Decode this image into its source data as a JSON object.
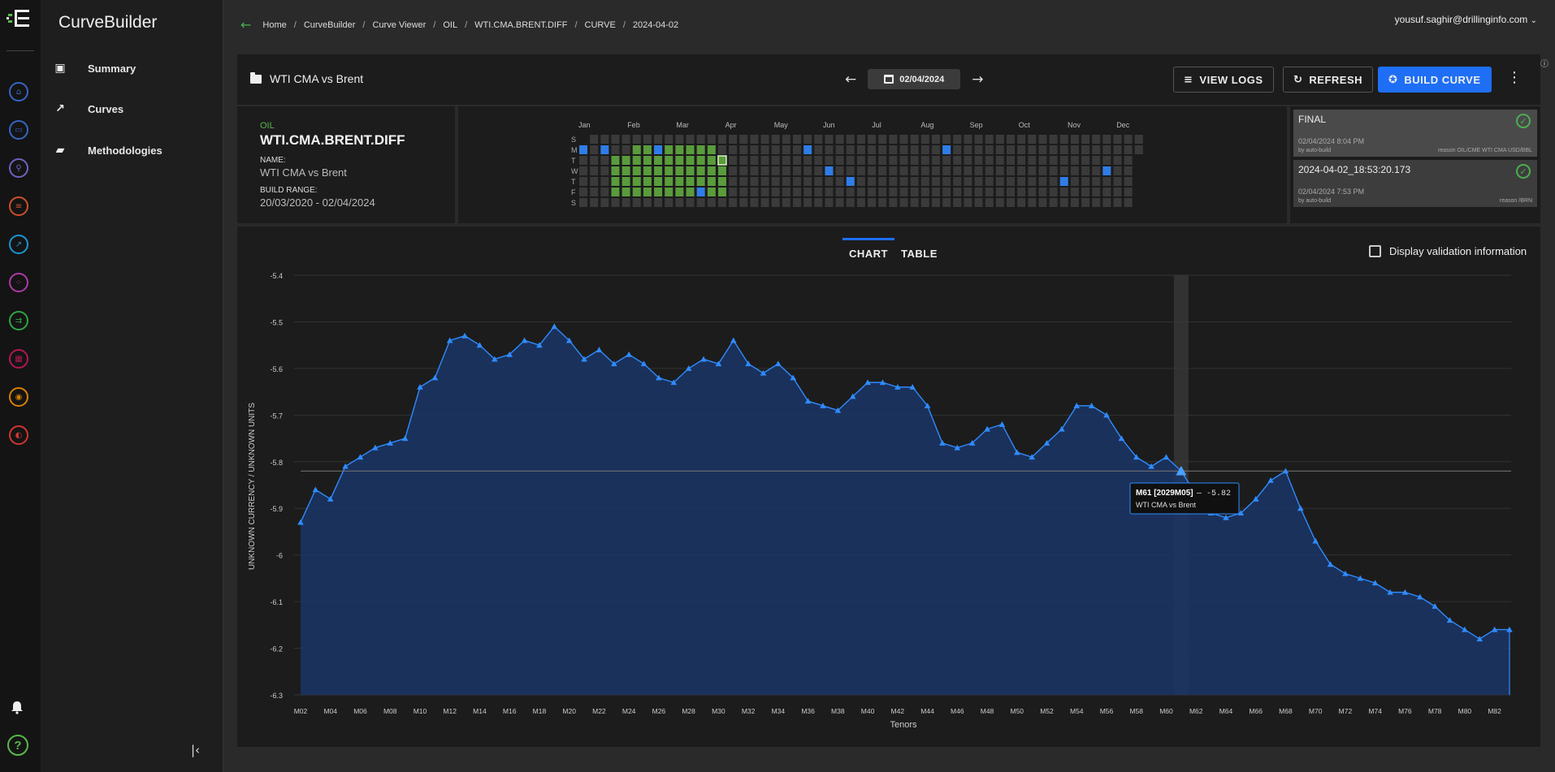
{
  "app": {
    "name": "CurveBuilder",
    "user": "yousuf.saghir@drillinginfo.com"
  },
  "nav": [
    {
      "label": "Summary",
      "icon": "id-card-icon"
    },
    {
      "label": "Curves",
      "icon": "trending-up-icon"
    },
    {
      "label": "Methodologies",
      "icon": "folder-chart-icon"
    }
  ],
  "rail_icons": [
    {
      "name": "bank-icon",
      "color": "#3a6ed8"
    },
    {
      "name": "folder-icon",
      "color": "#3a6ed8"
    },
    {
      "name": "database-search-icon",
      "color": "#7b6bd8"
    },
    {
      "name": "list-icon",
      "color": "#e4572e"
    },
    {
      "name": "trend-icon",
      "color": "#1aa3e8"
    },
    {
      "name": "scatter-icon",
      "color": "#c03fb8"
    },
    {
      "name": "flow-icon",
      "color": "#33b54a"
    },
    {
      "name": "calendar-icon",
      "color": "#c2185b"
    },
    {
      "name": "user-icon",
      "color": "#f08c00"
    },
    {
      "name": "gauge-icon",
      "color": "#e53935"
    }
  ],
  "breadcrumb": [
    "Home",
    "CurveBuilder",
    "Curve Viewer",
    "OIL",
    "WTI.CMA.BRENT.DIFF",
    "CURVE",
    "2024-04-02"
  ],
  "header": {
    "title": "WTI CMA vs Brent",
    "date": "02/04/2024",
    "view_logs": "VIEW LOGS",
    "refresh": "REFRESH",
    "build_curve": "BUILD CURVE"
  },
  "curve": {
    "commodity": "OIL",
    "code": "WTI.CMA.BRENT.DIFF",
    "name_label": "NAME:",
    "name": "WTI CMA vs Brent",
    "range_label": "BUILD RANGE:",
    "range": "20/03/2020 - 02/04/2024"
  },
  "calendar": {
    "months": [
      "Jan",
      "Feb",
      "Mar",
      "Apr",
      "May",
      "Jun",
      "Jul",
      "Aug",
      "Sep",
      "Oct",
      "Nov",
      "Dec"
    ],
    "days": [
      "S",
      "M",
      "T",
      "W",
      "T",
      "F",
      "S"
    ],
    "colors": {
      "empty": "#3a3a3a",
      "built": "#5a9b3c",
      "flagged": "#2f7de8",
      "selected": "#5a9b3c"
    }
  },
  "builds": [
    {
      "name": "FINAL",
      "date": "02/04/2024 8:04 PM",
      "by": "by auto-build",
      "reason": "reason OIL/CME WTI CMA USD/BBL",
      "status": "success"
    },
    {
      "name": "2024-04-02_18:53:20.173",
      "date": "02/04/2024 7:53 PM",
      "by": "by auto-build",
      "reason": "reason /BRN",
      "status": "success"
    }
  ],
  "tabs": {
    "chart": "CHART",
    "table": "TABLE"
  },
  "validation_label": "Display validation information",
  "tooltip": {
    "tenor": "M61 [2029M05]",
    "dash": "—",
    "value": "-5.82",
    "series": "WTI CMA vs Brent"
  },
  "colors": {
    "accent": "#1e6ff5",
    "line": "#2f8bff",
    "fill": "#1a3566",
    "green": "#4caf50"
  },
  "chart_data": {
    "type": "area",
    "xlabel": "Tenors",
    "ylabel": "UNKNOWN CURRENCY / UNKNOWN UNITS",
    "ylim": [
      -6.3,
      -5.4
    ],
    "yticks": [
      -5.4,
      -5.5,
      -5.6,
      -5.7,
      -5.8,
      -5.9,
      -6,
      -6.1,
      -6.2,
      -6.3
    ],
    "xticks": [
      "M02",
      "M04",
      "M06",
      "M08",
      "M10",
      "M12",
      "M14",
      "M16",
      "M18",
      "M20",
      "M22",
      "M24",
      "M26",
      "M28",
      "M30",
      "M32",
      "M34",
      "M36",
      "M38",
      "M40",
      "M42",
      "M44",
      "M46",
      "M48",
      "M50",
      "M52",
      "M54",
      "M56",
      "M58",
      "M60",
      "M62",
      "M64",
      "M66",
      "M68",
      "M70",
      "M72",
      "M74",
      "M76",
      "M78",
      "M80",
      "M82"
    ],
    "series": [
      {
        "name": "WTI CMA vs Brent",
        "x_start": "M02",
        "values": [
          -5.93,
          -5.86,
          -5.88,
          -5.81,
          -5.79,
          -5.77,
          -5.76,
          -5.75,
          -5.64,
          -5.62,
          -5.54,
          -5.53,
          -5.55,
          -5.58,
          -5.57,
          -5.54,
          -5.55,
          -5.51,
          -5.54,
          -5.58,
          -5.56,
          -5.59,
          -5.57,
          -5.59,
          -5.62,
          -5.63,
          -5.6,
          -5.58,
          -5.59,
          -5.54,
          -5.59,
          -5.61,
          -5.59,
          -5.62,
          -5.67,
          -5.68,
          -5.69,
          -5.66,
          -5.63,
          -5.63,
          -5.64,
          -5.64,
          -5.68,
          -5.76,
          -5.77,
          -5.76,
          -5.73,
          -5.72,
          -5.78,
          -5.79,
          -5.76,
          -5.73,
          -5.68,
          -5.68,
          -5.7,
          -5.75,
          -5.79,
          -5.81,
          -5.79,
          -5.82,
          -5.87,
          -5.91,
          -5.92,
          -5.91,
          -5.88,
          -5.84,
          -5.82,
          -5.9,
          -5.97,
          -6.02,
          -6.04,
          -6.05,
          -6.06,
          -6.08,
          -6.08,
          -6.09,
          -6.11,
          -6.14,
          -6.16,
          -6.18,
          -6.16,
          -6.16
        ]
      }
    ],
    "highlight": {
      "tenor": "M61",
      "value": -5.82
    }
  }
}
